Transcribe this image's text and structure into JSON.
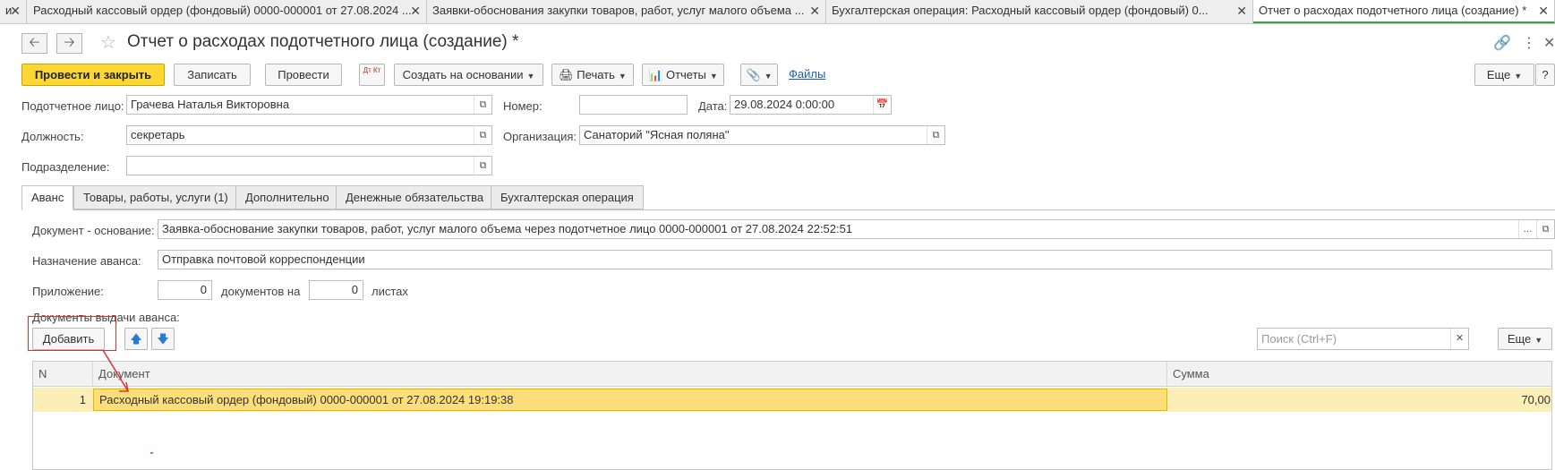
{
  "window_tabs": [
    {
      "label": "и",
      "active": false
    },
    {
      "label": "Расходный кассовый ордер (фондовый) 0000-000001 от 27.08.2024 ...",
      "active": false
    },
    {
      "label": "Заявки-обоснования закупки товаров, работ, услуг малого объема ...",
      "active": false
    },
    {
      "label": "Бухгалтерская операция: Расходный кассовый ордер (фондовый) 0...",
      "active": false
    },
    {
      "label": "Отчет о расходах подотчетного лица (создание) *",
      "active": true
    }
  ],
  "tab_close": "✕",
  "title": "Отчет о расходах подотчетного лица (создание) *",
  "toolbar": {
    "post_close": "Провести и закрыть",
    "save": "Записать",
    "post": "Провести",
    "dtkt": "Дт Кт",
    "create_based": "Создать на основании",
    "print": "Печать",
    "reports": "Отчеты",
    "files": "Файлы",
    "more": "Еще",
    "help": "?"
  },
  "header": {
    "person_label": "Подотчетное лицо:",
    "person_value": "Грачева Наталья Викторовна",
    "number_label": "Номер:",
    "number_value": "",
    "date_label": "Дата:",
    "date_value": "29.08.2024  0:00:00",
    "position_label": "Должность:",
    "position_value": "секретарь",
    "org_label": "Организация:",
    "org_value": "Санаторий \"Ясная поляна\"",
    "dept_label": "Подразделение:",
    "dept_value": ""
  },
  "form_tabs": [
    {
      "label": "Аванс",
      "active": true
    },
    {
      "label": "Товары, работы, услуги (1)",
      "active": false
    },
    {
      "label": "Дополнительно",
      "active": false
    },
    {
      "label": "Денежные обязательства",
      "active": false
    },
    {
      "label": "Бухгалтерская операция",
      "active": false
    }
  ],
  "advance": {
    "basis_label": "Документ - основание:",
    "basis_value": "Заявка-обоснование закупки товаров, работ, услуг малого объема через подотчетное лицо 0000-000001 от 27.08.2024 22:52:51",
    "purpose_label": "Назначение аванса:",
    "purpose_value": "Отправка почтовой корреспонденции",
    "attach_label": "Приложение:",
    "attach_docs": "0",
    "docs_on": "документов на",
    "attach_sheets": "0",
    "sheets": "листах",
    "issue_docs_label": "Документы выдачи аванса:",
    "add_button": "Добавить",
    "search_placeholder": "Поиск (Ctrl+F)",
    "more": "Еще"
  },
  "table": {
    "columns": [
      "N",
      "Документ",
      "Сумма"
    ],
    "rows": [
      {
        "n": "1",
        "document": "Расходный кассовый ордер (фондовый) 0000-000001 от 27.08.2024 19:19:38",
        "sum": "70,00"
      }
    ]
  },
  "colors": {
    "accent": "#fcd734",
    "selection": "#fbeeb7",
    "annotation": "#e0302a"
  }
}
